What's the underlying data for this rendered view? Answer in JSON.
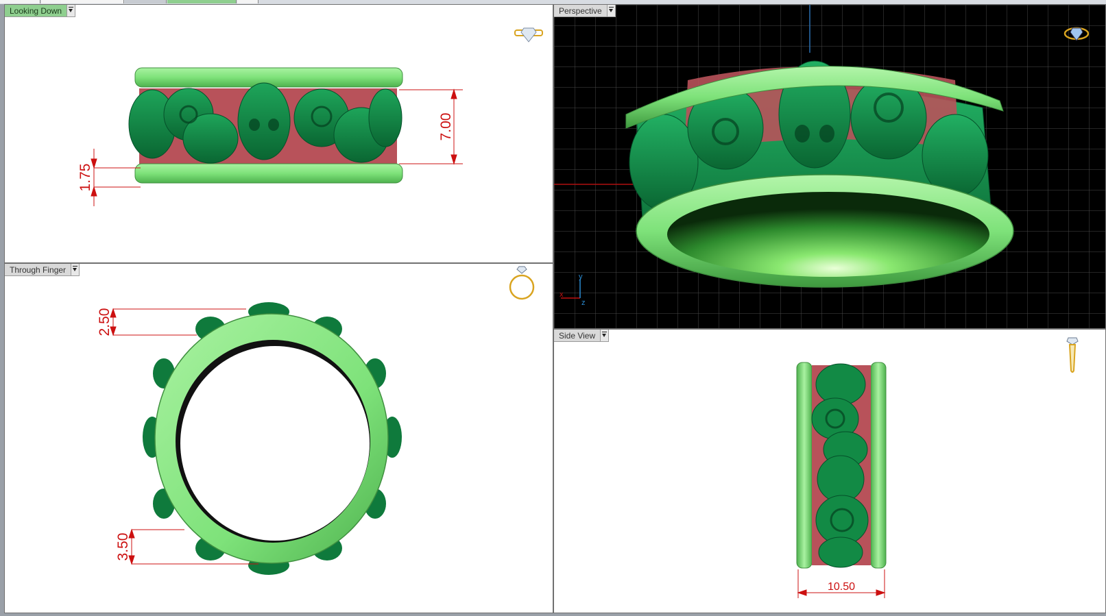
{
  "viewports": {
    "looking_down": {
      "title": "Looking Down",
      "active": true,
      "dims": {
        "band_height": "7.00",
        "rim_width": "1.75"
      }
    },
    "perspective": {
      "title": "Perspective",
      "axes": {
        "y": "y",
        "x": "x",
        "z": "z"
      }
    },
    "through_finger": {
      "title": "Through Finger",
      "dims": {
        "top_thickness": "2.50",
        "bottom_thickness": "3.50"
      }
    },
    "side_view": {
      "title": "Side View",
      "dims": {
        "width": "10.50"
      }
    }
  },
  "colors": {
    "light_green": "#7ee27a",
    "dark_green": "#128a45",
    "recess_red": "#b8525a",
    "dimension_red": "#cc1010",
    "grid_line": "#4a4a4a",
    "viewport_bg_light": "#ffffff",
    "viewport_bg_dark": "#000000"
  },
  "icons": {
    "looking_down": "ring-top-view-icon",
    "perspective": "ring-perspective-icon",
    "through_finger": "ring-front-view-icon",
    "side_view": "ring-side-view-icon"
  }
}
